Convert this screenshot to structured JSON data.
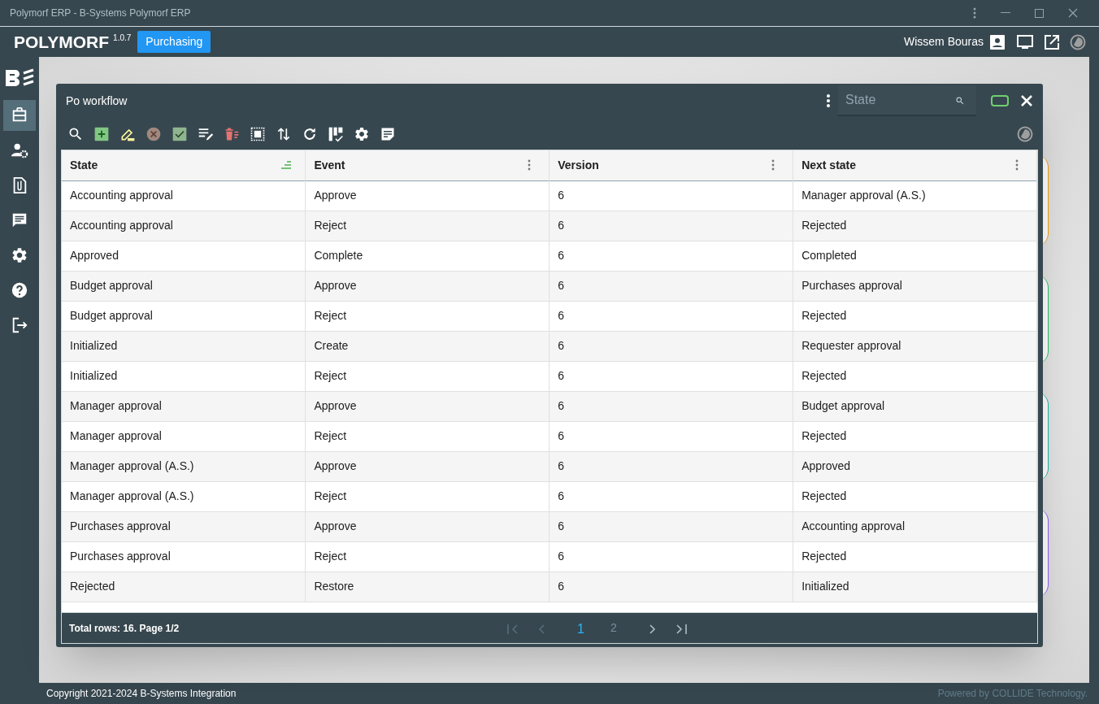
{
  "window": {
    "title": "Polymorf ERP - B-Systems Polymorf ERP"
  },
  "header": {
    "brand": "POLYMORF",
    "version": "1.0.7",
    "module": "Purchasing",
    "user": "Wissem Bouras"
  },
  "sidebar": {
    "items": [
      {
        "kind": "briefcase",
        "selected": true
      },
      {
        "kind": "user-settings",
        "selected": false
      },
      {
        "kind": "attachment",
        "selected": false
      },
      {
        "kind": "chat",
        "selected": false
      },
      {
        "kind": "settings",
        "selected": false
      },
      {
        "kind": "help",
        "selected": false
      },
      {
        "kind": "logout",
        "selected": false
      }
    ]
  },
  "dialog": {
    "title": "Po workflow",
    "search": {
      "placeholder": "State"
    },
    "toolbar": [
      {
        "kind": "search"
      },
      {
        "kind": "add"
      },
      {
        "kind": "edit"
      },
      {
        "kind": "cancel"
      },
      {
        "kind": "approve"
      },
      {
        "kind": "edit-list"
      },
      {
        "kind": "delete-list"
      },
      {
        "kind": "select-all"
      },
      {
        "kind": "sort"
      },
      {
        "kind": "refresh"
      },
      {
        "kind": "columns"
      },
      {
        "kind": "settings"
      },
      {
        "kind": "note"
      }
    ],
    "table": {
      "columns": [
        {
          "label": "State",
          "sorted": true
        },
        {
          "label": "Event",
          "sorted": false
        },
        {
          "label": "Version",
          "sorted": false
        },
        {
          "label": "Next state",
          "sorted": false
        }
      ],
      "rows": [
        [
          "Accounting approval",
          "Approve",
          "6",
          "Manager approval (A.S.)"
        ],
        [
          "Accounting approval",
          "Reject",
          "6",
          "Rejected"
        ],
        [
          "Approved",
          "Complete",
          "6",
          "Completed"
        ],
        [
          "Budget approval",
          "Approve",
          "6",
          "Purchases approval"
        ],
        [
          "Budget approval",
          "Reject",
          "6",
          "Rejected"
        ],
        [
          "Initialized",
          "Create",
          "6",
          "Requester approval"
        ],
        [
          "Initialized",
          "Reject",
          "6",
          "Rejected"
        ],
        [
          "Manager approval",
          "Approve",
          "6",
          "Budget approval"
        ],
        [
          "Manager approval",
          "Reject",
          "6",
          "Rejected"
        ],
        [
          "Manager approval (A.S.)",
          "Approve",
          "6",
          "Approved"
        ],
        [
          "Manager approval (A.S.)",
          "Reject",
          "6",
          "Rejected"
        ],
        [
          "Purchases approval",
          "Approve",
          "6",
          "Accounting approval"
        ],
        [
          "Purchases approval",
          "Reject",
          "6",
          "Rejected"
        ],
        [
          "Rejected",
          "Restore",
          "6",
          "Initialized"
        ]
      ]
    },
    "pager": {
      "summary": "Total rows: 16. Page 1/2",
      "pages": [
        {
          "label": "1",
          "selected": true
        },
        {
          "label": "2",
          "selected": false
        }
      ]
    }
  },
  "footer": {
    "copyright": "Copyright 2021-2024 B-Systems Integration",
    "powered_by": "Powered by COLLIDE Technology."
  }
}
